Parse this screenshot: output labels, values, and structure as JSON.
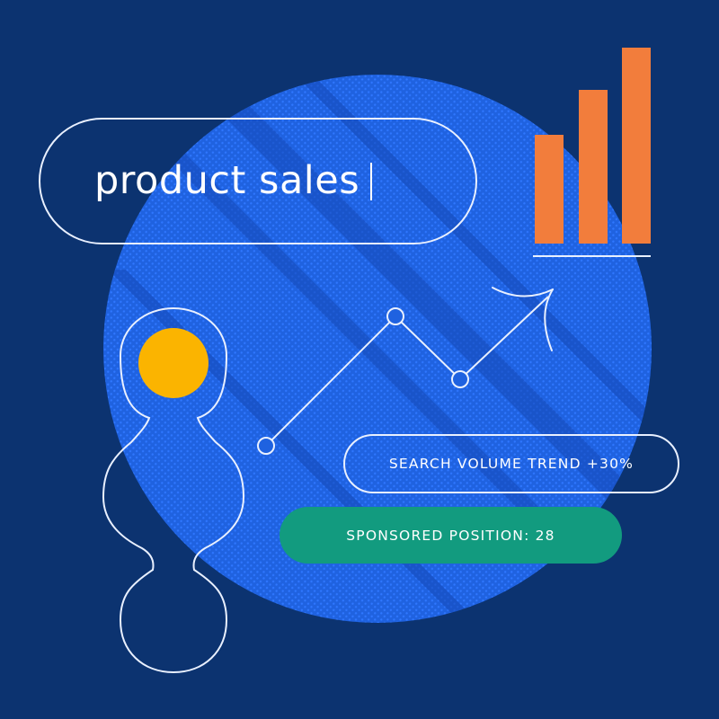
{
  "search": {
    "text": "product sales"
  },
  "badges": {
    "trend": "SEARCH VOLUME TREND +30%",
    "sponsored": "SPONSORED POSITION: 28"
  },
  "colors": {
    "background": "#0c3370",
    "globe": "#1f62e0",
    "bars": "#f27d3c",
    "dot": "#fbb400",
    "sponsored_badge": "#129b7f",
    "line": "#e9f0ff"
  },
  "icons": [
    "bar-chart-icon",
    "trend-line-icon",
    "arrow-icon",
    "text-caret"
  ]
}
